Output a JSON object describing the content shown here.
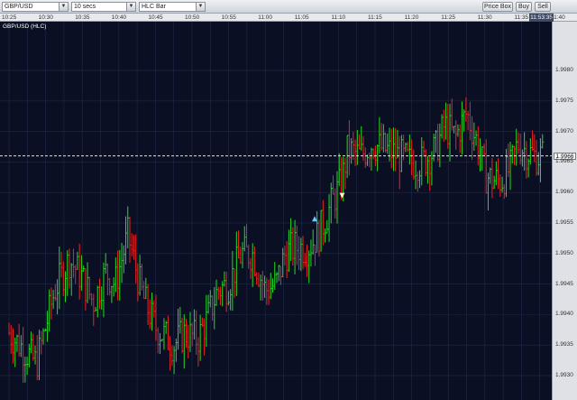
{
  "toolbar": {
    "instrument": "GBP/USD",
    "interval": "10 secs",
    "chart_style": "HLC Bar",
    "price_box_label": "Price Box",
    "buy_label": "Buy",
    "sell_label": "Sell"
  },
  "time_ruler": {
    "ticks": [
      "10:25",
      "10:30",
      "10:35",
      "10:40",
      "10:45",
      "10:50",
      "10:55",
      "11:00",
      "11:05",
      "11:10",
      "11:15",
      "11:20",
      "11:25",
      "11:30",
      "11:35",
      "11:40",
      "11"
    ],
    "current_time": "11:53:35"
  },
  "colors": {
    "background": "#0b0f24",
    "grid": "#1f2a49",
    "up": "#22dd22",
    "down": "#ee2222",
    "marker_buy": "#66ccff",
    "marker_sell": "#ffeecc"
  },
  "chart_data": {
    "type": "line",
    "title": "GBP/USD (HLC)",
    "ylim": [
      1.9926,
      1.9988
    ],
    "y_ticks": [
      "1.9980",
      "1.9975",
      "1.9970",
      "1.9965",
      "1.9960",
      "1.9955",
      "1.9950",
      "1.9945",
      "1.9940",
      "1.9935",
      "1.9930"
    ],
    "x_categories": [
      "10:25",
      "10:30",
      "10:35",
      "10:40",
      "10:45",
      "10:50",
      "10:55",
      "11:00",
      "11:05",
      "11:10",
      "11:15",
      "11:20",
      "11:25",
      "11:30",
      "11:35",
      "11:40"
    ],
    "current_price": "1.9966",
    "series": [
      {
        "values": [
          [
            0,
            1.9937
          ],
          [
            1.5,
            1.9932
          ],
          [
            2.5,
            1.9944
          ],
          [
            3.3,
            1.9949
          ],
          [
            4.0,
            1.9946
          ],
          [
            4.6,
            1.9942
          ],
          [
            5.3,
            1.9947
          ],
          [
            5.8,
            1.9945
          ],
          [
            6.5,
            1.9953
          ],
          [
            7.3,
            1.9943
          ],
          [
            8.0,
            1.9938
          ],
          [
            9.0,
            1.9935
          ],
          [
            9.6,
            1.9937
          ],
          [
            10.3,
            1.9936
          ],
          [
            10.8,
            1.9939
          ],
          [
            11.4,
            1.9944
          ],
          [
            12.0,
            1.9945
          ],
          [
            12.7,
            1.995
          ],
          [
            13.3,
            1.995
          ],
          [
            14.0,
            1.9944
          ],
          [
            14.6,
            1.9945
          ],
          [
            15.1,
            1.995
          ],
          [
            15.6,
            1.9951
          ],
          [
            16.3,
            1.9951
          ],
          [
            16.9,
            1.9953
          ],
          [
            17.6,
            1.9958
          ],
          [
            18.2,
            1.9962
          ],
          [
            18.5,
            1.9967
          ],
          [
            19.2,
            1.9966
          ],
          [
            19.8,
            1.9968
          ],
          [
            20.6,
            1.9967
          ],
          [
            21.3,
            1.9966
          ],
          [
            21.9,
            1.9965
          ],
          [
            22.6,
            1.9965
          ],
          [
            23.3,
            1.9967
          ],
          [
            23.8,
            1.9971
          ],
          [
            24.4,
            1.9969
          ],
          [
            25.0,
            1.9973
          ],
          [
            25.6,
            1.9968
          ],
          [
            26.0,
            1.9963
          ],
          [
            26.4,
            1.9962
          ],
          [
            26.9,
            1.9962
          ],
          [
            27.4,
            1.9964
          ],
          [
            27.8,
            1.9968
          ],
          [
            28.2,
            1.9967
          ],
          [
            28.7,
            1.9966
          ],
          [
            29.2,
            1.9966
          ]
        ]
      }
    ],
    "markers": [
      {
        "label": "buy-up-arrow",
        "x": 16.7,
        "y": 1.99557
      },
      {
        "label": "sell-down-arrow",
        "x": 18.2,
        "y": 1.99595
      }
    ]
  },
  "yaxis": {
    "ticks": [
      "1.9980",
      "1.9975",
      "1.9970",
      "1.9965",
      "1.9960",
      "1.9955",
      "1.9950",
      "1.9945",
      "1.9940",
      "1.9935",
      "1.9930"
    ],
    "current": "1.9966"
  }
}
